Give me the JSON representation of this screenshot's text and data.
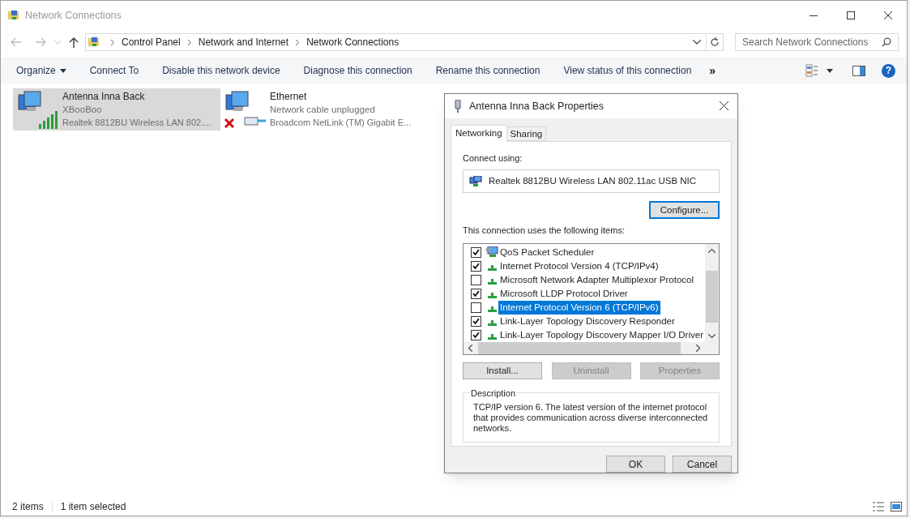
{
  "window": {
    "title": "Network Connections"
  },
  "address": {
    "breadcrumbs": [
      "Control Panel",
      "Network and Internet",
      "Network Connections"
    ]
  },
  "search": {
    "placeholder": "Search Network Connections"
  },
  "help": "?",
  "toolbar": {
    "commands": [
      {
        "label": "Organize",
        "dropdown": true
      },
      {
        "label": "Connect To",
        "dropdown": false
      },
      {
        "label": "Disable this network device",
        "dropdown": false
      },
      {
        "label": "Diagnose this connection",
        "dropdown": false
      },
      {
        "label": "Rename this connection",
        "dropdown": false
      },
      {
        "label": "View status of this connection",
        "dropdown": false
      }
    ],
    "overflow": "»"
  },
  "connections": [
    {
      "name": "Antenna Inna Back",
      "status": "XBooBoo",
      "device": "Realtek 8812BU Wireless LAN 802....",
      "kind": "wireless",
      "selected": true
    },
    {
      "name": "Ethernet",
      "status": "Network cable unplugged",
      "device": "Broadcom NetLink (TM) Gigabit E...",
      "kind": "wired",
      "selected": false
    }
  ],
  "status_bar": {
    "count": "2 items",
    "selection": "1 item selected"
  },
  "dialog": {
    "title": "Antenna Inna Back Properties",
    "tabs": [
      {
        "label": "Networking",
        "selected": true
      },
      {
        "label": "Sharing",
        "selected": false
      }
    ],
    "connect_using_label": "Connect using:",
    "adapter": "Realtek 8812BU Wireless LAN 802.11ac USB NIC",
    "configure_button": "Configure...",
    "items_label": "This connection uses the following items:",
    "items": [
      {
        "label": "QoS Packet Scheduler",
        "kind": "service",
        "checked": true,
        "selected": false
      },
      {
        "label": "Internet Protocol Version 4 (TCP/IPv4)",
        "kind": "protocol",
        "checked": true,
        "selected": false
      },
      {
        "label": "Microsoft Network Adapter Multiplexor Protocol",
        "kind": "protocol",
        "checked": false,
        "selected": false
      },
      {
        "label": "Microsoft LLDP Protocol Driver",
        "kind": "protocol",
        "checked": true,
        "selected": false
      },
      {
        "label": "Internet Protocol Version 6 (TCP/IPv6)",
        "kind": "protocol",
        "checked": false,
        "selected": true
      },
      {
        "label": "Link-Layer Topology Discovery Responder",
        "kind": "protocol",
        "checked": true,
        "selected": false
      },
      {
        "label": "Link-Layer Topology Discovery Mapper I/O Driver",
        "kind": "protocol",
        "checked": true,
        "selected": false
      }
    ],
    "item_buttons": [
      {
        "label": "Install...",
        "disabled": false
      },
      {
        "label": "Uninstall",
        "disabled": true
      },
      {
        "label": "Properties",
        "disabled": true
      }
    ],
    "description": {
      "legend": "Description",
      "text": "TCP/IP version 6. The latest version of the internet protocol that provides communication across diverse interconnected networks."
    },
    "footer_buttons": [
      "OK",
      "Cancel"
    ]
  }
}
